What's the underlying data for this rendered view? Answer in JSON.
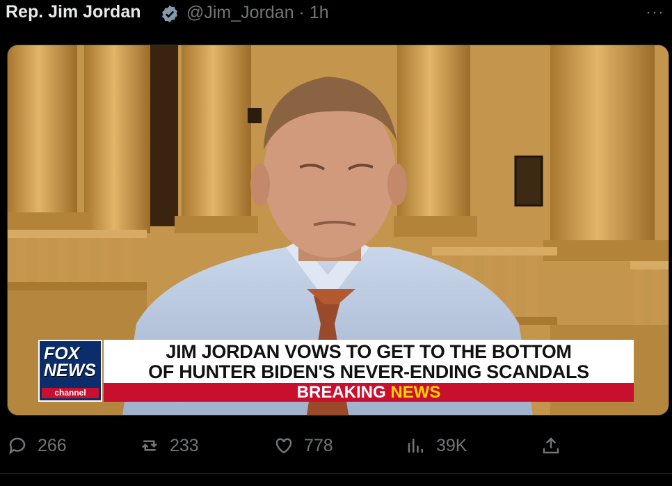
{
  "tweet": {
    "author_name": "Rep. Jim Jordan",
    "handle_time": "@Jim_Jordan · 1h",
    "more_label": "···",
    "verified_icon": "verified-badge-icon"
  },
  "media": {
    "network_logo": {
      "line1": "FOX",
      "line2": "NEWS",
      "line3": "channel"
    },
    "headline_line1": "JIM JORDAN VOWS TO GET TO THE BOTTOM",
    "headline_line2": "OF HUNTER BIDEN'S NEVER-ENDING SCANDALS",
    "banner_word1": "BREAKING",
    "banner_word2": "NEWS",
    "colors": {
      "banner_red": "#c8102e",
      "banner_yellow": "#ffd400",
      "fox_blue": "#0b2d6b"
    }
  },
  "actions": {
    "replies": "266",
    "reposts": "233",
    "likes": "778",
    "views": "39K"
  },
  "icons": [
    "reply-icon",
    "repost-icon",
    "like-icon",
    "views-icon",
    "share-icon"
  ]
}
